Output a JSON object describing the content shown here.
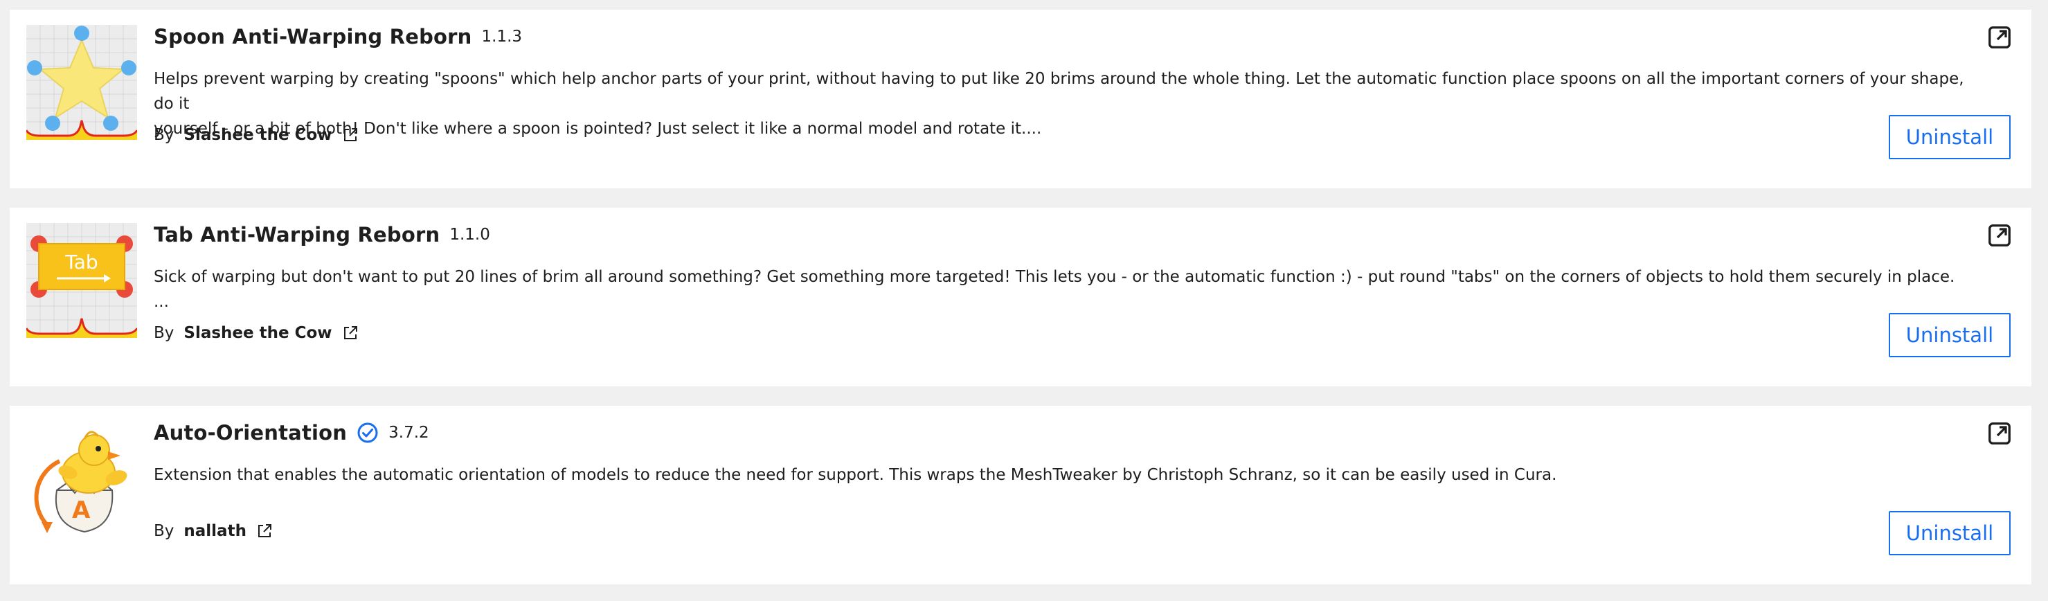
{
  "packages": [
    {
      "name": "Spoon Anti-Warping Reborn",
      "version": "1.1.3",
      "verified": false,
      "description": "Helps prevent warping by creating \"spoons\" which help anchor parts of your print, without having to put like 20 brims around the whole thing. Let the automatic function place spoons on all the important corners of your shape, do it\nyourself - or a bit of both! Don't like where a spoon is pointed? Just select it like a normal model and rotate it....",
      "by_label": "By",
      "author": "Slashee the Cow",
      "action_label": "Uninstall",
      "icon": "spoon-plugin-icon"
    },
    {
      "name": "Tab Anti-Warping Reborn",
      "version": "1.1.0",
      "verified": false,
      "description": "Sick of warping but don't want to put 20 lines of brim all around something? Get something more targeted! This lets you - or the automatic function :) - put round \"tabs\" on the corners of objects to hold them securely in place.\n...",
      "by_label": "By",
      "author": "Slashee the Cow",
      "action_label": "Uninstall",
      "icon": "tab-plugin-icon",
      "icon_text": "Tab"
    },
    {
      "name": "Auto-Orientation",
      "version": "3.7.2",
      "verified": true,
      "description": "Extension that enables the automatic orientation of models to reduce the need for support. This wraps the MeshTweaker by Christoph Schranz, so it can be easily used in Cura.",
      "by_label": "By",
      "author": "nallath",
      "action_label": "Uninstall",
      "icon": "auto-orientation-chick-icon",
      "icon_text": "A"
    }
  ],
  "colors": {
    "accent": "#196ef0",
    "card_bg": "#ffffff",
    "page_bg": "#f0f0f0",
    "text": "#1e1e1e"
  }
}
